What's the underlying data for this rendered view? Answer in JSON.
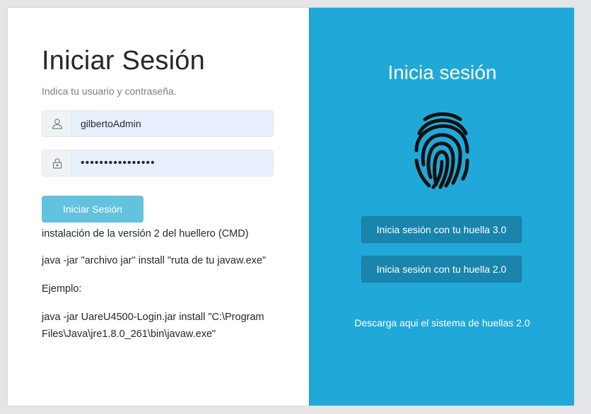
{
  "login": {
    "title": "Iniciar Sesión",
    "subtitle": "Indica tu usuario y contraseña.",
    "username_value": "gilbertoAdmin",
    "password_value": "••••••••••••••••",
    "submit_label": "Iniciar Sesión"
  },
  "notes": {
    "line1": "instalación de la versión 2 del huellero (CMD)",
    "line2": "java -jar \"archivo jar\" install \"ruta de tu javaw.exe\"",
    "line3": "Ejemplo:",
    "line4": "java -jar UareU4500-Login.jar install \"C:\\Program Files\\Java\\jre1.8.0_261\\bin\\javaw.exe\""
  },
  "fingerprint_panel": {
    "title": "Inicia sesión",
    "icon": "fingerprint-icon",
    "button_v3": "Inicia sesión con tu huella 3.0",
    "button_v2": "Inicia sesión con tu huella 2.0",
    "download_link": "Descarga aqui el sistema de huellas 2.0"
  },
  "colors": {
    "panel_bg": "#20a8d8",
    "panel_button": "#1985ac",
    "login_button": "#63c2de",
    "input_autofill": "#e8f0fe"
  }
}
